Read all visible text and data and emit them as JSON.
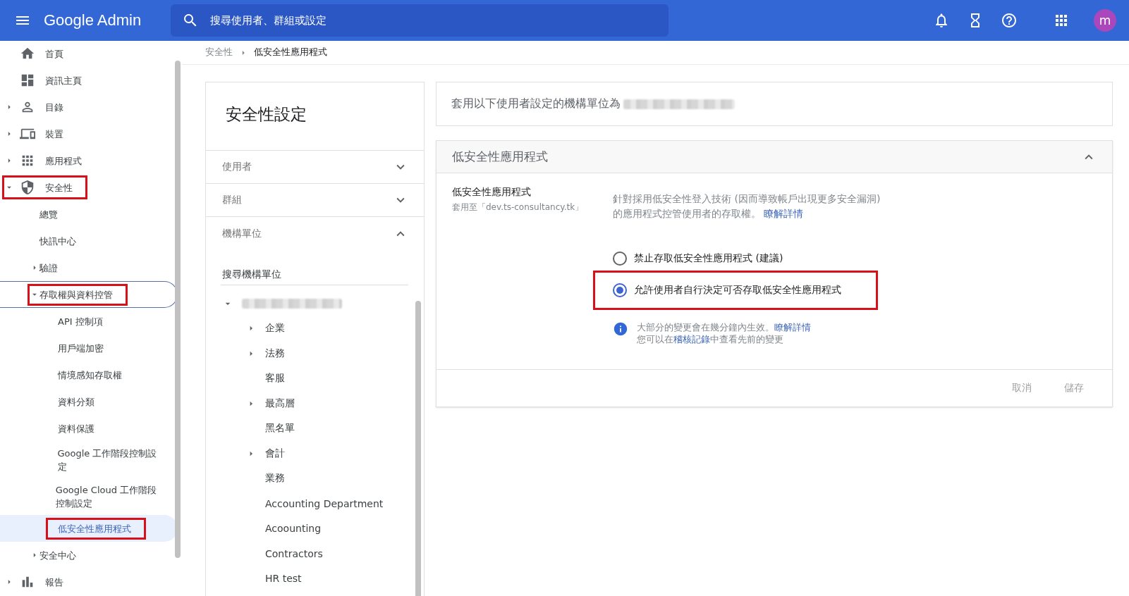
{
  "header": {
    "title": "Google Admin",
    "search": {
      "placeholder": "搜尋使用者、群組或設定"
    },
    "avatar": "m"
  },
  "sidebar": {
    "items": [
      {
        "label": "首頁"
      },
      {
        "label": "資訊主頁"
      },
      {
        "label": "目錄",
        "expanded": false
      },
      {
        "label": "裝置",
        "expanded": false
      },
      {
        "label": "應用程式",
        "expanded": false
      },
      {
        "label": "安全性",
        "expanded": true,
        "annotated": true,
        "children": [
          {
            "label": "總覽"
          },
          {
            "label": "快訊中心"
          },
          {
            "label": "驗證",
            "expanded": false
          },
          {
            "label": "存取權與資料控管",
            "expanded": true,
            "annotated": true,
            "focused": true,
            "children": [
              {
                "label": "API 控制項"
              },
              {
                "label": "用戶端加密"
              },
              {
                "label": "情境感知存取權"
              },
              {
                "label": "資料分類"
              },
              {
                "label": "資料保護"
              },
              {
                "label": "Google 工作階段控制設定"
              },
              {
                "label": "Google Cloud 工作階段控制設定"
              },
              {
                "label": "低安全性應用程式",
                "selected": true,
                "annotated": true
              }
            ]
          },
          {
            "label": "安全中心",
            "expanded": false
          }
        ]
      },
      {
        "label": "報告",
        "expanded": false
      }
    ]
  },
  "breadcrumb": [
    "安全性",
    "低安全性應用程式"
  ],
  "settings_panel": {
    "title": "安全性設定",
    "sections": [
      {
        "label": "使用者",
        "expanded": false
      },
      {
        "label": "群組",
        "expanded": false
      },
      {
        "label": "機構單位",
        "expanded": true
      }
    ],
    "search": {
      "placeholder": "搜尋機構單位"
    },
    "tree": [
      {
        "kind": "redacted",
        "expanded": true,
        "children": [
          {
            "label": "企業",
            "expanded": false
          },
          {
            "label": "法務",
            "expanded": false
          },
          {
            "label": "客服"
          },
          {
            "label": "最高層",
            "expanded": false
          },
          {
            "label": "黑名單"
          },
          {
            "label": "會計",
            "expanded": false
          },
          {
            "label": "業務"
          },
          {
            "label": "Accounting Department"
          },
          {
            "label": "Acoounting"
          },
          {
            "label": "Contractors"
          },
          {
            "label": "HR test"
          }
        ]
      }
    ]
  },
  "ou_banner": {
    "text": "套用以下使用者設定的機構單位為",
    "redacted": true
  },
  "setting_card": {
    "title": "低安全性應用程式",
    "expanded": true,
    "name": "低安全性應用程式",
    "applies_to": "套用至「dev.ts-consultancy.tk」",
    "description": "針對採用低安全性登入技術 (因而導致帳戶出現更多安全漏洞) 的應用程式控管使用者的存取權。",
    "description_link": "瞭解詳情",
    "options": [
      {
        "label": "禁止存取低安全性應用程式 (建議)",
        "selected": false,
        "annotated": false
      },
      {
        "label": "允許使用者自行決定可否存取低安全性應用程式",
        "selected": true,
        "annotated": true
      }
    ],
    "info": [
      {
        "before": "大部分的變更會在幾分鐘內生效。",
        "link": "瞭解詳情"
      },
      {
        "before": "您可以在",
        "link": "稽核記錄",
        "after": "中查看先前的變更"
      }
    ],
    "buttons": [
      {
        "label": "取消",
        "disabled": true
      },
      {
        "label": "儲存",
        "disabled": true
      }
    ]
  }
}
